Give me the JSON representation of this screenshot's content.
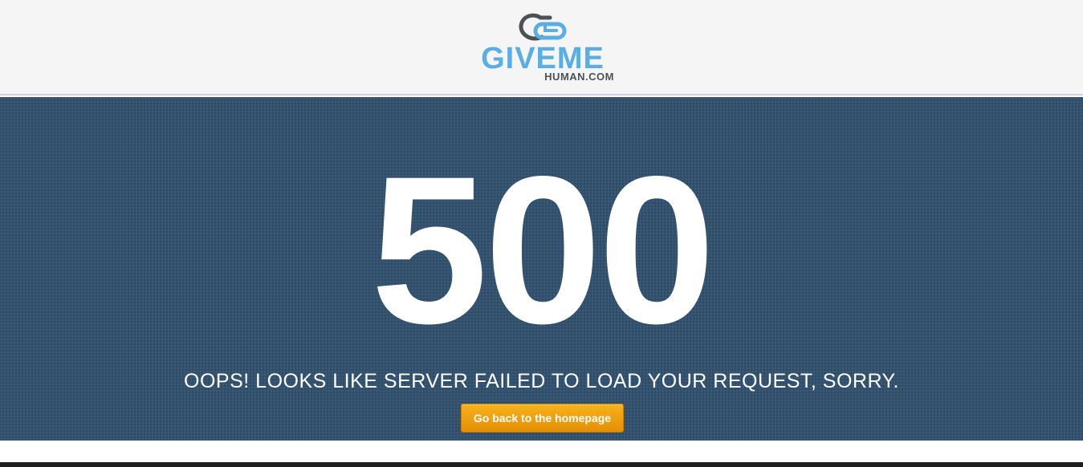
{
  "header": {
    "logo": {
      "icon": "gh-chain-link-icon",
      "word": "GIVEME",
      "sub": "HUMAN.COM",
      "colors": {
        "primary": "#5aaee3",
        "dark": "#4d5157"
      }
    }
  },
  "hero": {
    "error_code": "500",
    "message": "OOPS! LOOKS LIKE SERVER FAILED TO LOAD YOUR REQUEST, SORRY.",
    "button_label": "Go back to the homepage",
    "colors": {
      "background": "#33526f",
      "button": "#f2a40f",
      "text": "#ffffff"
    }
  }
}
